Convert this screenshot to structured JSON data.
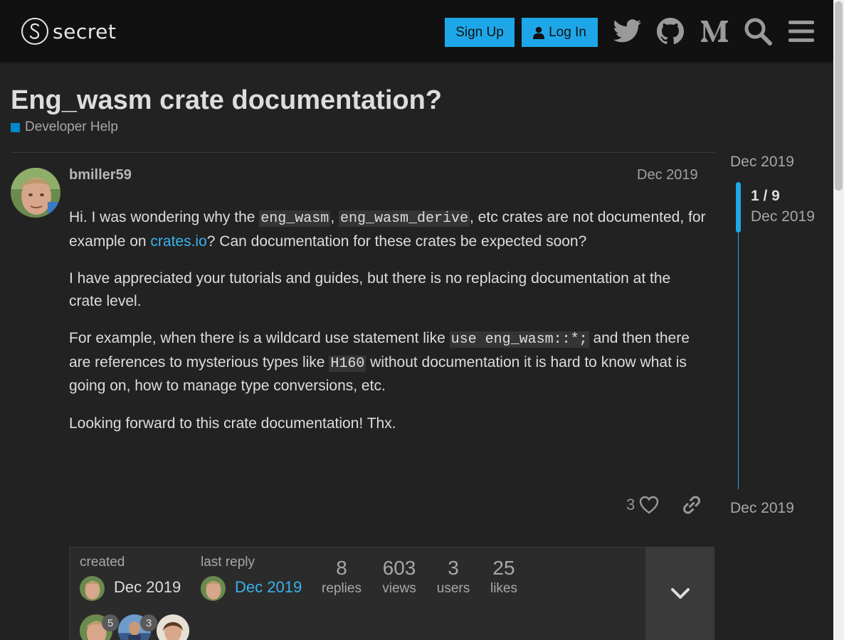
{
  "header": {
    "logo_text": "secret",
    "signup_label": "Sign Up",
    "login_label": "Log In",
    "icons": [
      "twitter-icon",
      "github-icon",
      "medium-icon",
      "search-icon",
      "hamburger-menu-icon"
    ]
  },
  "topic": {
    "title": "Eng_wasm crate documentation?",
    "category": "Developer Help",
    "category_color": "#0088cc"
  },
  "post": {
    "username": "bmiller59",
    "date": "Dec 2019",
    "p1_a": "Hi. I was wondering why the ",
    "p1_code1": "eng_wasm",
    "p1_b": ", ",
    "p1_code2": "eng_wasm_derive",
    "p1_c": ", etc crates are not documented, for example on ",
    "p1_link": "crates.io",
    "p1_d": "? Can documentation for these crates be expected soon?",
    "p2": "I have appreciated your tutorials and guides, but there is no replacing documentation at the crate level.",
    "p3_a": "For example, when there is a wildcard use statement like ",
    "p3_code1": "use eng_wasm::*;",
    "p3_b": " and then there are references to mysterious types like ",
    "p3_code2": "H160",
    "p3_c": " without documentation it is hard to know what is going on, how to manage type conversions, etc.",
    "p4": "Looking forward to this crate documentation! Thx.",
    "likes": "3"
  },
  "timeline": {
    "top_date": "Dec 2019",
    "position": "1 / 9",
    "handle_date": "Dec 2019",
    "bottom_date": "Dec 2019"
  },
  "topic_map": {
    "created_label": "created",
    "created_date": "Dec 2019",
    "last_reply_label": "last reply",
    "last_reply_date": "Dec 2019",
    "stats": [
      {
        "num": "8",
        "label": "replies"
      },
      {
        "num": "603",
        "label": "views"
      },
      {
        "num": "3",
        "label": "users"
      },
      {
        "num": "25",
        "label": "likes"
      }
    ],
    "participants": [
      {
        "count": "5"
      },
      {
        "count": "3"
      },
      {
        "count": ""
      }
    ]
  },
  "colors": {
    "accent": "#1ea7e8",
    "background": "#222222",
    "header": "#111111"
  }
}
